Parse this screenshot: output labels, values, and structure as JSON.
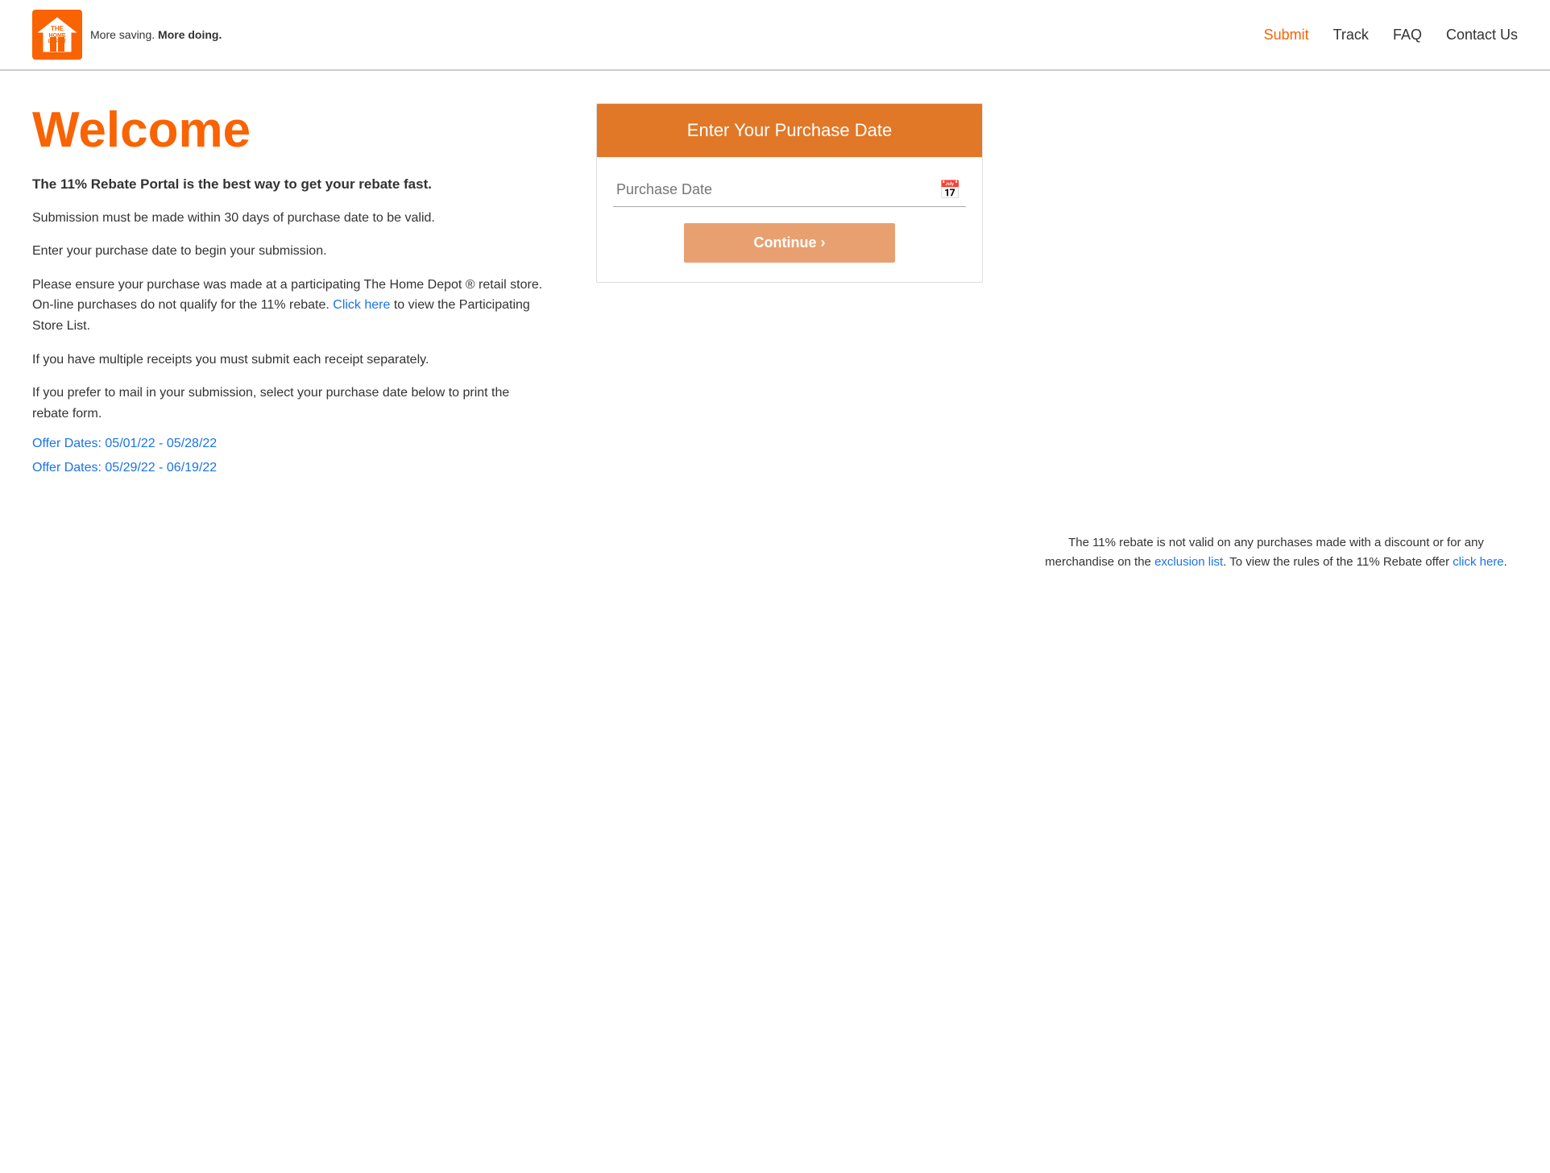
{
  "header": {
    "tagline": "More saving. ",
    "tagline_bold": "More doing.",
    "nav": {
      "submit": "Submit",
      "track": "Track",
      "faq": "FAQ",
      "contact": "Contact Us"
    }
  },
  "welcome": {
    "title": "Welcome",
    "intro_bold": "The 11% Rebate Portal is the best way to get your rebate fast.",
    "para1": "Submission must be made within 30 days of purchase date to be valid.",
    "para2": "Enter your purchase date to begin your submission.",
    "para3_pre": "Please ensure your purchase was made at a participating The Home Depot ® retail store. On-line purchases do not qualify for the 11% rebate. ",
    "para3_link": "Click here",
    "para3_post": " to view the Participating Store List.",
    "para4": "If you have multiple receipts you must submit each receipt separately.",
    "para5": "If you prefer to mail in your submission, select your purchase date below to print the rebate form.",
    "offer1": "Offer Dates: 05/01/22 - 05/28/22",
    "offer2": "Offer Dates: 05/29/22 - 06/19/22"
  },
  "form": {
    "header": "Enter Your Purchase Date",
    "date_placeholder": "Purchase Date",
    "continue_label": "Continue ›"
  },
  "disclaimer": {
    "text_pre": "The 11% rebate is not valid on any purchases made with a discount or for any merchandise on the ",
    "exclusion_link": "exclusion list",
    "text_mid": ". To view the rules of the 11% Rebate offer ",
    "rules_link": "click here",
    "text_post": "."
  }
}
